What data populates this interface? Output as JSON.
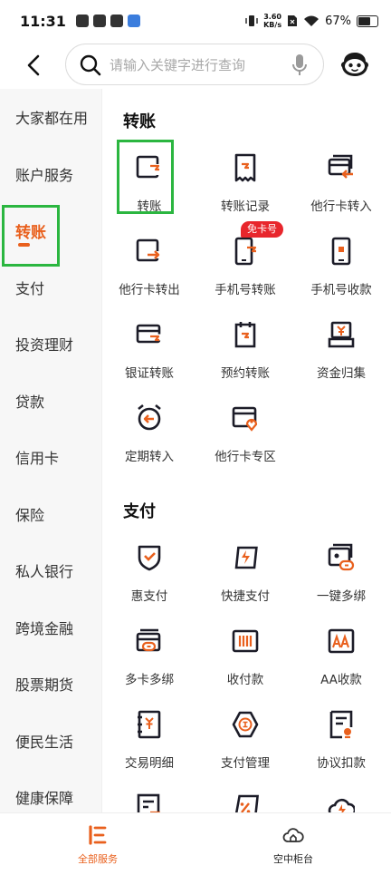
{
  "status_bar": {
    "time": "11:31",
    "net_speed_value": "3.60",
    "net_speed_unit": "KB/s",
    "battery": "67%"
  },
  "header": {
    "search_placeholder": "请输入关键字进行查询"
  },
  "sidebar": {
    "items": [
      "大家都在用",
      "账户服务",
      "转账",
      "支付",
      "投资理财",
      "贷款",
      "信用卡",
      "保险",
      "私人银行",
      "跨境金融",
      "股票期货",
      "便民生活",
      "健康保障"
    ],
    "active_index": 2
  },
  "sections": [
    {
      "title": "转账",
      "items": [
        "转账",
        "转账记录",
        "他行卡转入",
        "他行卡转出",
        "手机号转账",
        "手机号收款",
        "银证转账",
        "预约转账",
        "资金归集",
        "定期转入",
        "他行卡专区"
      ]
    },
    {
      "title": "支付",
      "items": [
        "惠支付",
        "快捷支付",
        "一键多绑",
        "多卡多绑",
        "收付款",
        "AA收款",
        "交易明细",
        "支付管理",
        "协议扣款"
      ]
    }
  ],
  "badge": "免卡号",
  "bottom_nav": [
    "全部服务",
    "空中柜台"
  ],
  "colors": {
    "accent": "#e9601d",
    "highlight_box": "#2bb640",
    "badge": "#e8262c",
    "icon_dark": "#1c1c28"
  },
  "icons": [
    "transfer-icon",
    "receipt-icon",
    "card-in-icon",
    "card-out-icon",
    "phone-transfer-icon",
    "phone-receive-icon",
    "securities-icon",
    "schedule-icon",
    "fund-icon",
    "alarm-clock-icon",
    "card-location-icon",
    "shield-icon",
    "lightning-card-icon",
    "link-card-icon",
    "multi-card-icon",
    "cash-register-icon",
    "aa-icon",
    "detail-icon",
    "hexagon-pay-icon",
    "contract-icon"
  ]
}
